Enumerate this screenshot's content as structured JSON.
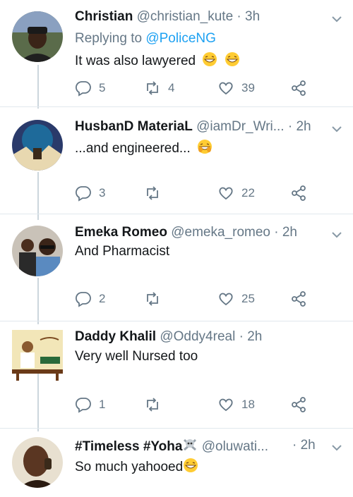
{
  "tweets": [
    {
      "name": "Christian",
      "handle": "@christian_kute · 3h",
      "reply_prefix": "Replying to ",
      "reply_mention": "@PoliceNG",
      "text": "It was also lawyered",
      "replies": "5",
      "retweets": "4",
      "likes": "39",
      "avatar_color": "#5a6b4a"
    },
    {
      "name": "HusbanD MateriaL",
      "handle": "@iamDr_Wri... · 2h",
      "text": "...and engineered...",
      "replies": "3",
      "retweets": "",
      "likes": "22",
      "avatar_color": "#2a3a6a"
    },
    {
      "name": "Emeka Romeo",
      "handle": "@emeka_romeo · 2h",
      "text": "And Pharmacist",
      "replies": "2",
      "retweets": "",
      "likes": "25",
      "avatar_color": "#c9c2b8"
    },
    {
      "name": "Daddy Khalil",
      "handle": "@Oddy4real · 2h",
      "text": "Very well Nursed too",
      "replies": "1",
      "retweets": "",
      "likes": "18",
      "avatar_color": "#e8d9a0"
    },
    {
      "name": "#Timeless #Yoha",
      "handle": "@oluwati...",
      "time": "· 2h",
      "text": "So much yahooed",
      "avatar_color": "#6b4a32"
    }
  ],
  "colors": {
    "secondary": "#657786",
    "link": "#1da1f2",
    "divider": "#e1e8ed"
  },
  "icons": [
    "reply-icon",
    "retweet-icon",
    "like-icon",
    "share-icon",
    "chevron-down-icon",
    "laughing-emoji",
    "skull-crossbones-emoji"
  ]
}
